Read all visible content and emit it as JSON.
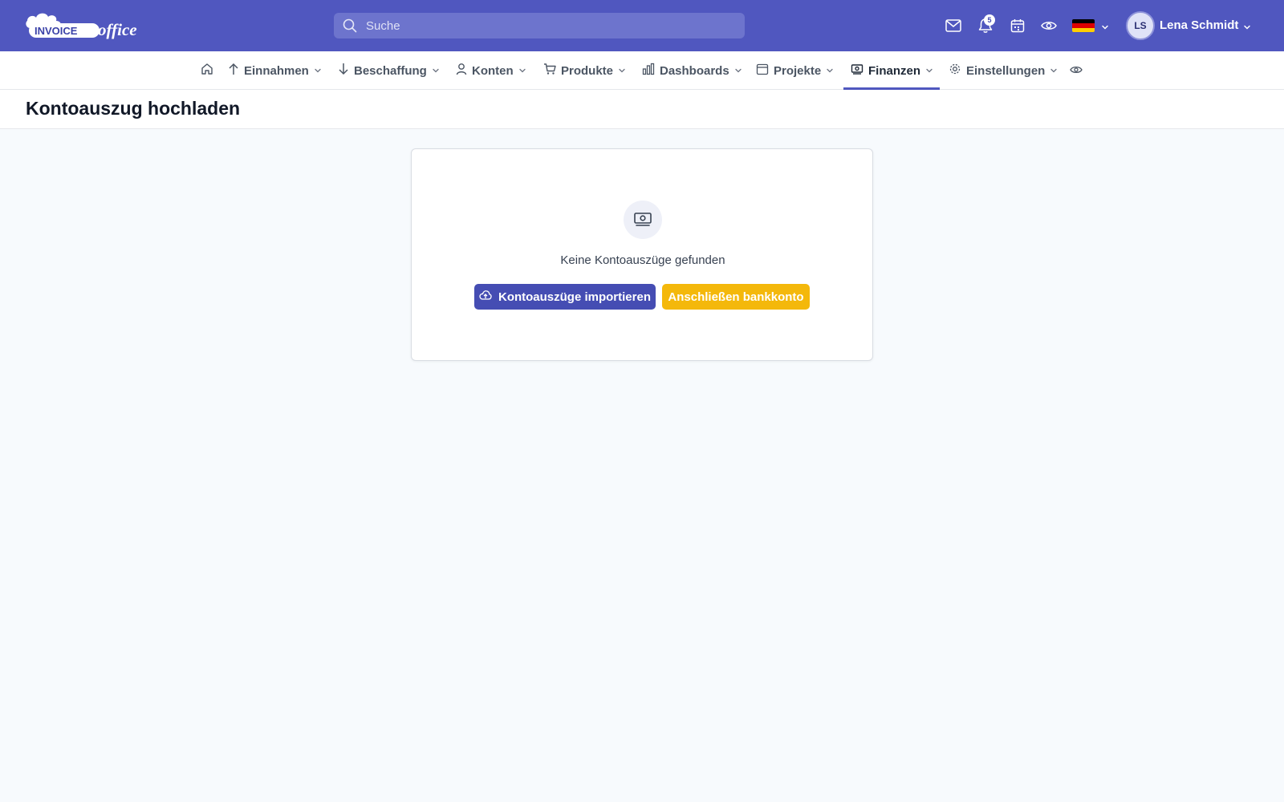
{
  "brand": {
    "logo_left": "INVOICE",
    "logo_right": "office"
  },
  "search": {
    "placeholder": "Suche"
  },
  "topbar": {
    "notification_count": "5",
    "icons": [
      "mail-icon",
      "bell-icon",
      "calendar-icon",
      "eye-icon"
    ],
    "language": "de",
    "user": {
      "initials": "LS",
      "name": "Lena Schmidt"
    }
  },
  "nav": {
    "items": [
      {
        "label": "",
        "icon": "home-icon"
      },
      {
        "label": "Einnahmen",
        "icon": "arrow-up-icon"
      },
      {
        "label": "Beschaffung",
        "icon": "arrow-down-icon"
      },
      {
        "label": "Konten",
        "icon": "user-icon"
      },
      {
        "label": "Produkte",
        "icon": "cart-icon"
      },
      {
        "label": "Dashboards",
        "icon": "bar-chart-icon"
      },
      {
        "label": "Projekte",
        "icon": "calendar-icon"
      },
      {
        "label": "Finanzen",
        "icon": "money-icon",
        "active": true
      },
      {
        "label": "Einstellungen",
        "icon": "gear-icon"
      },
      {
        "label": "",
        "icon": "eye-icon"
      }
    ]
  },
  "page": {
    "title": "Kontoauszug hochladen"
  },
  "empty_state": {
    "message": "Keine Kontoauszüge gefunden",
    "import_button": "Kontoauszüge importieren",
    "connect_button": "Anschließen bankkonto"
  },
  "colors": {
    "primary": "#5057bf",
    "primary_button": "#454db3",
    "warning_button": "#f4b80b",
    "background": "#f7fafd"
  }
}
